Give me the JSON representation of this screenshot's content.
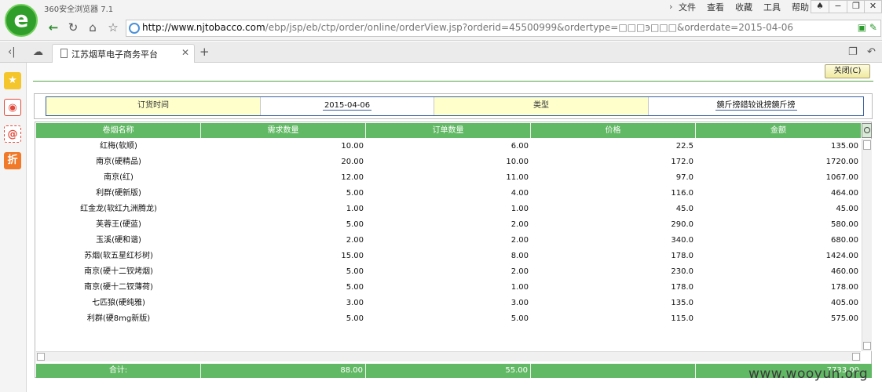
{
  "browser": {
    "app_title": "360安全浏览器 7.1",
    "menu": [
      "文件",
      "查看",
      "收藏",
      "工具",
      "帮助"
    ],
    "url_host": "http://www.njtobacco.com",
    "url_path": "/ebp/jsp/eb/ctp/order/online/orderView.jsp?orderid=45500999&ordertype=□□□э□□□&orderdate=2015-04-06",
    "tab_title": "江苏烟草电子商务平台"
  },
  "page": {
    "close_label": "关闭(C)",
    "info": {
      "order_time_label": "订货时间",
      "order_time_value": "2015-04-06",
      "type_label": "类型",
      "type_value": "鏡斤搒錯较讹搒鏡斤搒"
    },
    "columns": [
      "卷烟名称",
      "需求数量",
      "订单数量",
      "价格",
      "金额"
    ],
    "rows": [
      [
        "红梅(软顺)",
        "10.00",
        "6.00",
        "22.5",
        "135.00"
      ],
      [
        "南京(硬精品)",
        "20.00",
        "10.00",
        "172.0",
        "1720.00"
      ],
      [
        "南京(红)",
        "12.00",
        "11.00",
        "97.0",
        "1067.00"
      ],
      [
        "利群(硬新版)",
        "5.00",
        "4.00",
        "116.0",
        "464.00"
      ],
      [
        "红金龙(软红九洲腾龙)",
        "1.00",
        "1.00",
        "45.0",
        "45.00"
      ],
      [
        "芙蓉王(硬蓝)",
        "5.00",
        "2.00",
        "290.0",
        "580.00"
      ],
      [
        "玉溪(硬和谐)",
        "2.00",
        "2.00",
        "340.0",
        "680.00"
      ],
      [
        "苏烟(软五星红杉树)",
        "15.00",
        "8.00",
        "178.0",
        "1424.00"
      ],
      [
        "南京(硬十二钗烤烟)",
        "5.00",
        "2.00",
        "230.0",
        "460.00"
      ],
      [
        "南京(硬十二钗薄荷)",
        "5.00",
        "1.00",
        "178.0",
        "178.00"
      ],
      [
        "七匹狼(硬纯雅)",
        "3.00",
        "3.00",
        "135.0",
        "405.00"
      ],
      [
        "利群(硬8mg新版)",
        "5.00",
        "5.00",
        "115.0",
        "575.00"
      ]
    ],
    "totals": {
      "label": "合计:",
      "demand": "88.00",
      "ordered": "55.00",
      "price": "",
      "amount": "7733.00"
    }
  },
  "watermark": "www.wooyun.org",
  "colors": {
    "header_green": "#62b965",
    "label_yellow": "#ffffcc",
    "brand_green": "#2f9e2a"
  }
}
